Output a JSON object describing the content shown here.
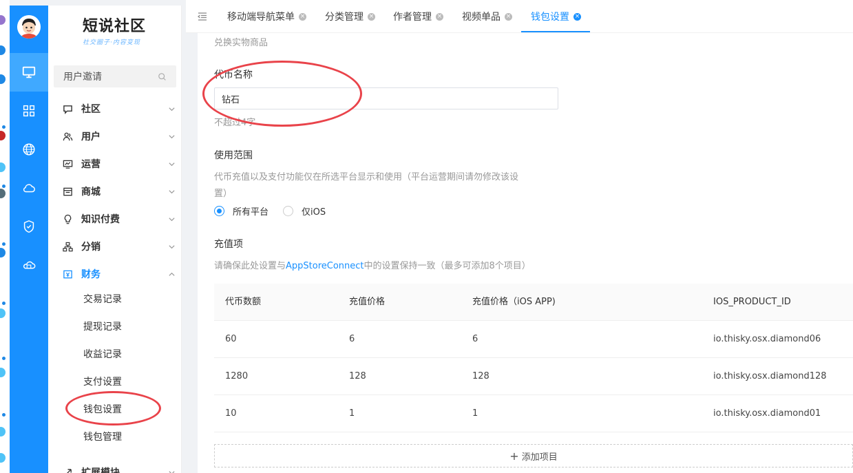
{
  "colors": {
    "accent": "#1890ff",
    "rail": "#1890ff",
    "annotation": "#e9434a"
  },
  "brand": {
    "title": "短说社区",
    "subtitle": "社交圈子·内容变现"
  },
  "menu": {
    "search_label": "用户邀请",
    "groups": [
      {
        "label": "社区",
        "icon": "chat-icon"
      },
      {
        "label": "用户",
        "icon": "users-icon"
      },
      {
        "label": "运营",
        "icon": "monitor-icon"
      },
      {
        "label": "商城",
        "icon": "shop-icon"
      },
      {
        "label": "知识付费",
        "icon": "bulb-icon"
      },
      {
        "label": "分销",
        "icon": "tree-icon"
      },
      {
        "label": "财务",
        "icon": "finance-icon"
      },
      {
        "label": "扩展模块",
        "icon": "extension-icon"
      }
    ],
    "finance_items": [
      "交易记录",
      "提现记录",
      "收益记录",
      "支付设置",
      "钱包设置",
      "钱包管理"
    ]
  },
  "tabs": [
    {
      "label": "移动端导航菜单"
    },
    {
      "label": "分类管理"
    },
    {
      "label": "作者管理"
    },
    {
      "label": "视频单品"
    },
    {
      "label": "钱包设置",
      "active": true
    }
  ],
  "form": {
    "top_hint": "兑换实物商品",
    "coin_name_label": "代币名称",
    "coin_name_value": "钻石",
    "coin_name_hint": "不超过4字",
    "scope_label": "使用范围",
    "scope_desc_line1": "代币充值以及支付功能仅在所选平台显示和使用（平台运营期间请勿修改该设",
    "scope_desc_line2": "置）",
    "scope_options": [
      "所有平台",
      "仅iOS"
    ],
    "scope_selected": "所有平台",
    "recharge_label": "充值项",
    "recharge_desc_prefix": "请确保此处设置与",
    "recharge_desc_link": "AppStoreConnect",
    "recharge_desc_suffix": "中的设置保持一致（最多可添加8个项目）",
    "add_label": "添加项目"
  },
  "table": {
    "headers": [
      "代币数额",
      "充值价格",
      "充值价格（iOS APP)",
      "IOS_PRODUCT_ID"
    ],
    "rows": [
      [
        "60",
        "6",
        "6",
        "io.thisky.osx.diamond06"
      ],
      [
        "1280",
        "128",
        "128",
        "io.thisky.osx.diamond128"
      ],
      [
        "10",
        "1",
        "1",
        "io.thisky.osx.diamond01"
      ]
    ]
  }
}
